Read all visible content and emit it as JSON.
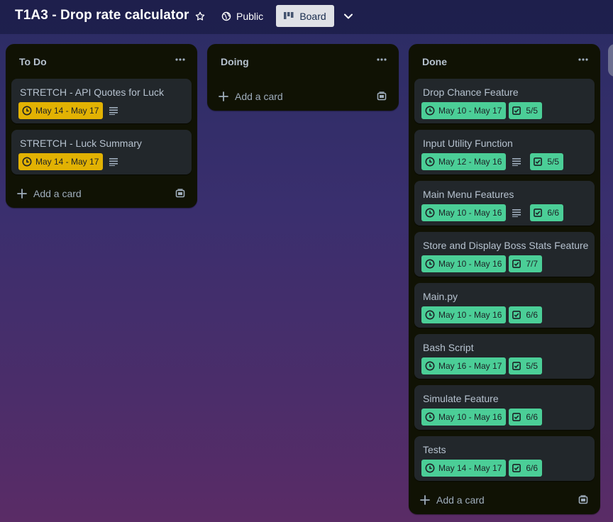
{
  "header": {
    "board_title": "T1A3 - Drop rate calculator",
    "visibility_label": "Public",
    "view_label": "Board"
  },
  "colors": {
    "list_bg": "#101204",
    "card_bg": "#22272b",
    "date_yellow": "#e2b203",
    "date_green": "#4bce97"
  },
  "lists": [
    {
      "title": "To Do",
      "add_card_label": "Add a card",
      "cards": [
        {
          "title": "STRETCH - API Quotes for Luck",
          "dates": "May 14 - May 17",
          "has_description": true
        },
        {
          "title": "STRETCH - Luck Summary",
          "dates": "May 14 - May 17",
          "has_description": true
        }
      ]
    },
    {
      "title": "Doing",
      "add_card_label": "Add a card",
      "cards": []
    },
    {
      "title": "Done",
      "add_card_label": "Add a card",
      "cards": [
        {
          "title": "Drop Chance Feature",
          "dates": "May 10 - May 17",
          "checklist": "5/5",
          "has_description": false
        },
        {
          "title": "Input Utility Function",
          "dates": "May 12 - May 16",
          "checklist": "5/5",
          "has_description": true
        },
        {
          "title": "Main Menu Features",
          "dates": "May 10 - May 16",
          "checklist": "6/6",
          "has_description": true
        },
        {
          "title": "Store and Display Boss Stats Feature",
          "dates": "May 10 - May 16",
          "checklist": "7/7",
          "has_description": false
        },
        {
          "title": "Main.py",
          "dates": "May 10 - May 16",
          "checklist": "6/6",
          "has_description": false
        },
        {
          "title": "Bash Script",
          "dates": "May 16 - May 17",
          "checklist": "5/5",
          "has_description": false
        },
        {
          "title": "Simulate Feature",
          "dates": "May 10 - May 16",
          "checklist": "6/6",
          "has_description": false
        },
        {
          "title": "Tests",
          "dates": "May 14 - May 17",
          "checklist": "6/6",
          "has_description": false
        }
      ]
    }
  ]
}
